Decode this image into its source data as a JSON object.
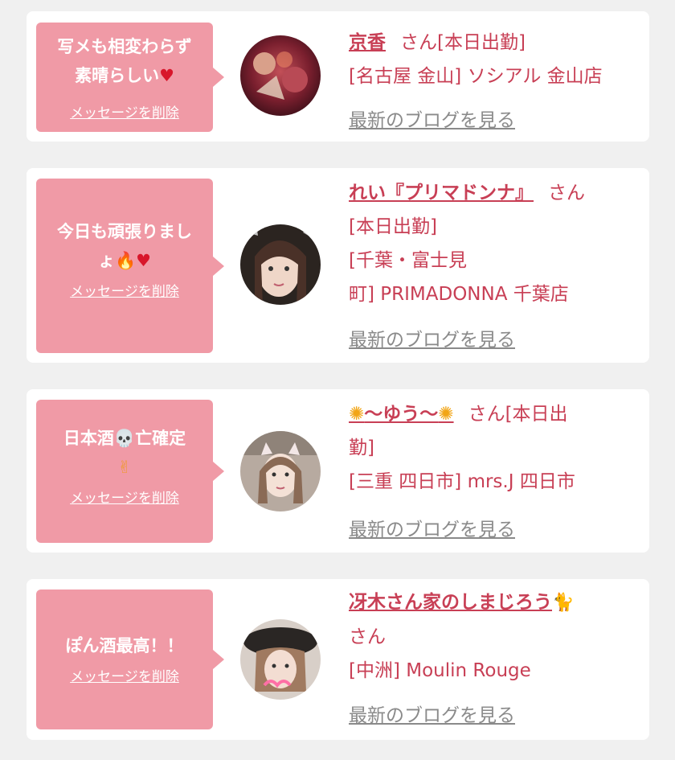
{
  "favorites": [
    {
      "message": "写メも相変わらず素晴らしい",
      "message_lines": [
        "写メも相変わらず",
        "素晴らしい"
      ],
      "delete_label": "メッセージを削除",
      "name": "京香",
      "honorific": "さん",
      "status": "[本日出勤]",
      "location": "[名古屋 金山] ソシアル 金山店",
      "blog_label": "最新のブログを見る"
    },
    {
      "message": "今日も頑張りましょ",
      "message_lines": [
        "今日も頑張りまし",
        "ょ"
      ],
      "delete_label": "メッセージを削除",
      "name": "れい『プリマドンナ』",
      "honorific": "さん",
      "status": "[本日出勤]",
      "location_lines": [
        "[千葉・富士見",
        "町] PRIMADONNA 千葉店"
      ],
      "blog_label": "最新のブログを見る"
    },
    {
      "message": "日本酒亡確定",
      "message_lines": [
        "日本酒",
        "亡確定"
      ],
      "delete_label": "メッセージを削除",
      "name": "〜ゆう〜",
      "honorific": "さん",
      "status_lines": [
        "[本日出",
        "勤]"
      ],
      "location": "[三重 四日市] mrs.J 四日市",
      "blog_label": "最新のブログを見る"
    },
    {
      "message": "ぽん酒最高！！",
      "delete_label": "メッセージを削除",
      "name": "冴木さん家のしまじろう",
      "honorific": "さん",
      "location": "[中洲] Moulin Rouge",
      "blog_label": "最新のブログを見る"
    }
  ],
  "icons": {
    "heart": "heart-icon",
    "fire": "fire-icon",
    "skull": "skull-icon",
    "peace": "peace-hand-icon",
    "sunflower": "sunflower-icon",
    "cat": "black-cat-icon"
  },
  "colors": {
    "background": "#f0f0f0",
    "card": "#ffffff",
    "bubble": "#f09aa6",
    "accent_text": "#c83f55",
    "link_gray": "#8a8a8a"
  }
}
